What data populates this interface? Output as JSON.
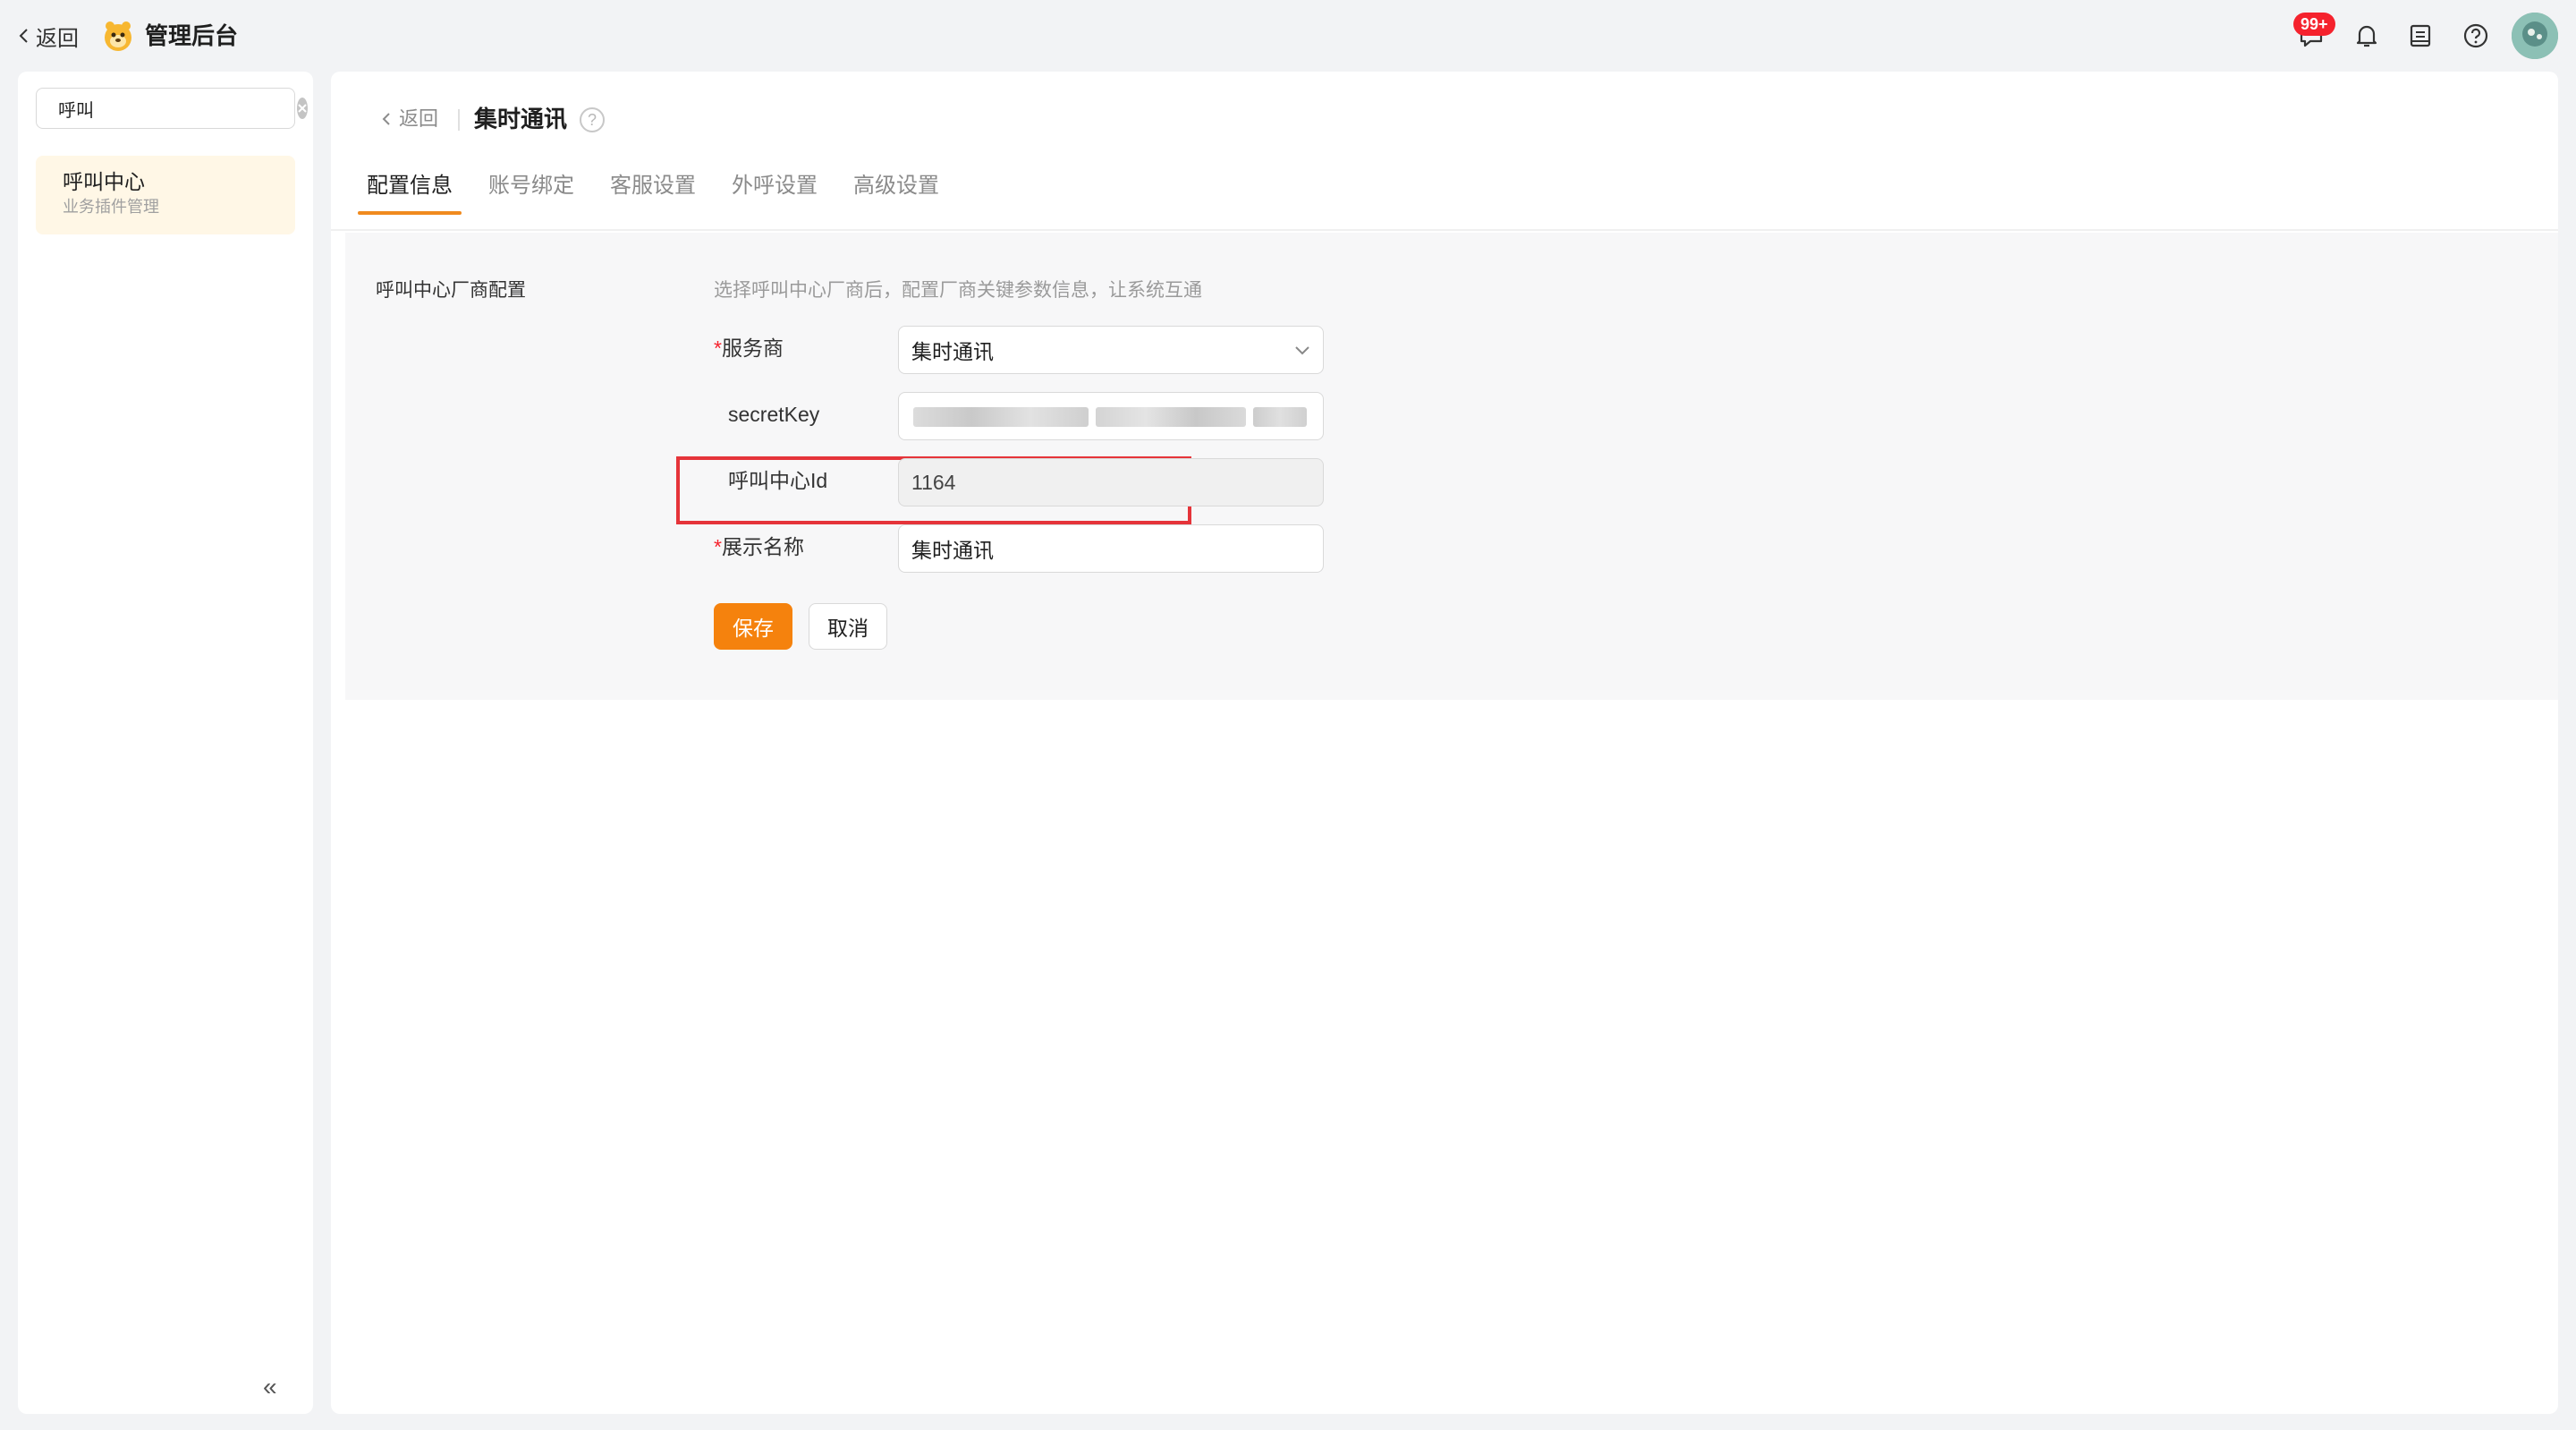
{
  "topbar": {
    "back_label": "返回",
    "app_title": "管理后台",
    "message_badge": "99+",
    "icons": [
      "message-icon",
      "bell-icon",
      "document-icon",
      "help-icon",
      "avatar"
    ]
  },
  "sidebar": {
    "search_value": "呼叫",
    "items": [
      {
        "title": "呼叫中心",
        "subtitle": "业务插件管理"
      }
    ],
    "collapse_symbol": "«"
  },
  "main": {
    "back_label": "返回",
    "title": "集时通讯",
    "help_symbol": "?",
    "tabs": [
      {
        "label": "配置信息",
        "active": true
      },
      {
        "label": "账号绑定"
      },
      {
        "label": "客服设置"
      },
      {
        "label": "外呼设置"
      },
      {
        "label": "高级设置"
      }
    ],
    "section": {
      "label": "呼叫中心厂商配置",
      "description": "选择呼叫中心厂商后，配置厂商关键参数信息，让系统互通"
    },
    "form": {
      "provider": {
        "label": "服务商",
        "required": true,
        "value": "集时通讯"
      },
      "secret_key": {
        "label": "secretKey",
        "required": false,
        "value_masked": true
      },
      "call_center_id": {
        "label": "呼叫中心Id",
        "required": false,
        "value": "1164"
      },
      "display_name": {
        "label": "展示名称",
        "required": true,
        "value": "集时通讯"
      }
    },
    "buttons": {
      "save": "保存",
      "cancel": "取消"
    }
  },
  "colors": {
    "accent": "#f5820d",
    "highlight_box": "#e5343a",
    "badge": "#f5222d",
    "required_star": "#f5222d"
  }
}
